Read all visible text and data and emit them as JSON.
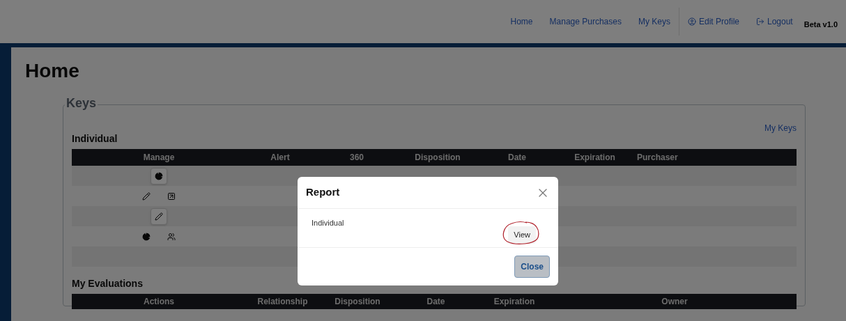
{
  "nav": {
    "links": [
      {
        "label": "Home",
        "kind": "text"
      },
      {
        "label": "Manage Purchases",
        "kind": "text"
      },
      {
        "label": "My Keys",
        "kind": "text"
      },
      {
        "label": "Edit Profile",
        "kind": "profile"
      },
      {
        "label": "Logout",
        "kind": "logout"
      }
    ],
    "version": "Beta v1.0"
  },
  "page_title": "Home",
  "keys": {
    "legend": "Keys",
    "link": "My Keys",
    "section": "Individual",
    "columns": [
      "Manage",
      "Alert",
      "360",
      "Disposition",
      "Date",
      "Expiration",
      "Purchaser"
    ],
    "rows": [
      {
        "actions": [
          {
            "kind": "chart",
            "boxed": true
          }
        ]
      },
      {
        "actions": [
          {
            "kind": "edit",
            "boxed": false
          },
          {
            "kind": "open",
            "boxed": false
          }
        ]
      },
      {
        "actions": [
          {
            "kind": "edit",
            "boxed": true
          }
        ]
      },
      {
        "actions": [
          {
            "kind": "chart",
            "boxed": false
          },
          {
            "kind": "team",
            "boxed": false
          }
        ]
      },
      {
        "actions": []
      }
    ]
  },
  "evaluations": {
    "section": "My Evaluations",
    "columns": [
      "Actions",
      "Relationship",
      "Disposition",
      "Date",
      "Expiration",
      "Owner"
    ]
  },
  "modal": {
    "title": "Report",
    "items": [
      {
        "label": "Individual",
        "button": "View"
      }
    ],
    "close_button": "Close"
  }
}
